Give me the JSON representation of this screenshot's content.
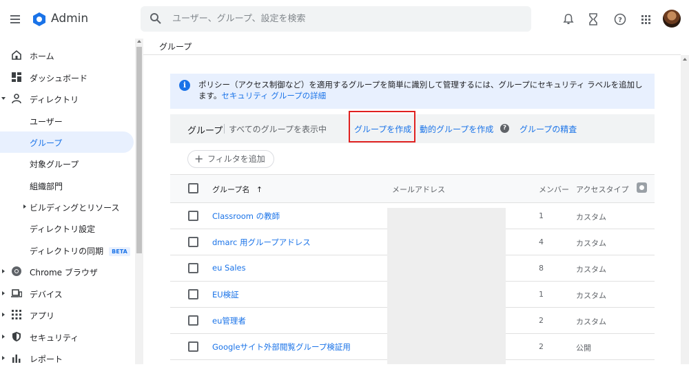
{
  "app": {
    "title": "Admin"
  },
  "search": {
    "placeholder": "ユーザー、グループ、設定を検索"
  },
  "sidebar": {
    "items": [
      {
        "label": "ホーム"
      },
      {
        "label": "ダッシュボード"
      },
      {
        "label": "ディレクトリ"
      },
      {
        "label": "ユーザー"
      },
      {
        "label": "グループ"
      },
      {
        "label": "対象グループ"
      },
      {
        "label": "組織部門"
      },
      {
        "label": "ビルディングとリソース"
      },
      {
        "label": "ディレクトリ設定"
      },
      {
        "label": "ディレクトリの同期",
        "badge": "BETA"
      },
      {
        "label": "Chrome ブラウザ"
      },
      {
        "label": "デバイス"
      },
      {
        "label": "アプリ"
      },
      {
        "label": "セキュリティ"
      },
      {
        "label": "レポート"
      }
    ]
  },
  "breadcrumb": {
    "label": "グループ"
  },
  "info": {
    "text": "ポリシー（アクセス制御など）を適用するグループを簡単に識別して管理するには、グループにセキュリティ ラベルを追加します。",
    "link": "セキュリティ グループの詳細"
  },
  "card": {
    "title": "グループ",
    "subtitle": "すべてのグループを表示中",
    "create_group": "グループを作成",
    "create_dynamic": "動的グループを作成",
    "inspect": "グループの精査",
    "add_filter": "フィルタを追加"
  },
  "table": {
    "columns": {
      "name": "グループ名",
      "email": "メールアドレス",
      "members": "メンバー",
      "access": "アクセスタイプ"
    },
    "sort_indicator": "↑",
    "rows": [
      {
        "name": "Classroom の教師",
        "members": "1",
        "access": "カスタム"
      },
      {
        "name": "dmarc 用グループアドレス",
        "members": "4",
        "access": "カスタム"
      },
      {
        "name": "eu Sales",
        "members": "8",
        "access": "カスタム"
      },
      {
        "name": "EU検証",
        "members": "1",
        "access": "カスタム"
      },
      {
        "name": "eu管理者",
        "members": "2",
        "access": "カスタム"
      },
      {
        "name": "Googleサイト外部閲覧グループ検証用",
        "members": "2",
        "access": "公開"
      }
    ]
  },
  "colors": {
    "accent": "#1a73e8",
    "highlight": "#e0201f",
    "active_bg": "#e8f0fe"
  }
}
